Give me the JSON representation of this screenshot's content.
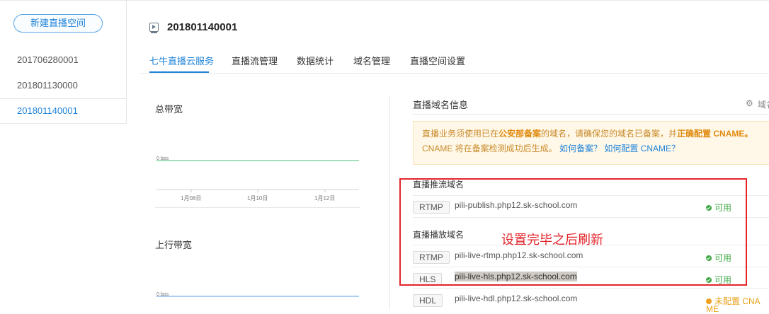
{
  "sidebar": {
    "new_button": "新建直播空间",
    "items": [
      {
        "label": "201706280001",
        "active": false
      },
      {
        "label": "201801130000",
        "active": false
      },
      {
        "label": "201801140001",
        "active": true
      }
    ]
  },
  "header": {
    "title": "201801140001",
    "tabs": [
      {
        "label": "七牛直播云服务",
        "active": true
      },
      {
        "label": "直播流管理",
        "active": false
      },
      {
        "label": "数据统计",
        "active": false
      },
      {
        "label": "域名管理",
        "active": false
      },
      {
        "label": "直播空间设置",
        "active": false
      }
    ]
  },
  "charts": [
    {
      "title": "总带宽",
      "value_label": "0 bps",
      "ticks": [
        "1月08日",
        "1月10日",
        "1月12日"
      ]
    },
    {
      "title": "上行带宽",
      "value_label": "0 bps"
    }
  ],
  "domain_info": {
    "title": "直播域名信息",
    "settings_label": "域名",
    "notice": {
      "line1_a": "直播业务须使用已在",
      "line1_b": "公安部备案",
      "line1_c": "的域名，请确保您的域名已备案，并",
      "line1_d": "正确配置 CNAME。",
      "line2_a": "CNAME 将在备案检测成功后生成。",
      "link1": "如何备案？",
      "link2": "如何配置 CNAME？"
    },
    "publish_title": "直播推流域名",
    "play_title": "直播播放域名",
    "rows": [
      {
        "proto": "RTMP",
        "domain": "pili-publish.php12.sk-school.com",
        "status": "可用"
      },
      {
        "proto": "RTMP",
        "domain": "pili-live-rtmp.php12.sk-school.com",
        "status": "可用"
      },
      {
        "proto": "HLS",
        "domain": "pili-live-hls.php12.sk-school.com",
        "status": "可用"
      },
      {
        "proto": "HDL",
        "domain": "pili-live-hdl.php12.sk-school.com",
        "status": "未配置 CNA",
        "status_sub": "ME"
      }
    ]
  },
  "annotation": "设置完毕之后刷新",
  "colors": {
    "accent": "#1f83d9",
    "ok": "#3ea844",
    "warn": "#e8a21a",
    "annotation": "#e3242b"
  }
}
